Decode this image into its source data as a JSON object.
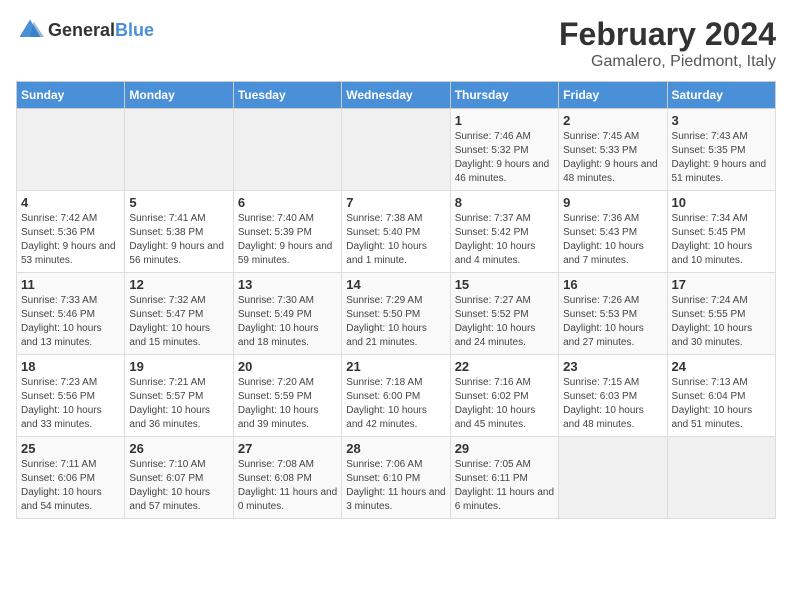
{
  "header": {
    "logo_general": "General",
    "logo_blue": "Blue",
    "title": "February 2024",
    "subtitle": "Gamalero, Piedmont, Italy"
  },
  "calendar": {
    "days_of_week": [
      "Sunday",
      "Monday",
      "Tuesday",
      "Wednesday",
      "Thursday",
      "Friday",
      "Saturday"
    ],
    "weeks": [
      [
        {
          "day": "",
          "info": ""
        },
        {
          "day": "",
          "info": ""
        },
        {
          "day": "",
          "info": ""
        },
        {
          "day": "",
          "info": ""
        },
        {
          "day": "1",
          "info": "Sunrise: 7:46 AM\nSunset: 5:32 PM\nDaylight: 9 hours\nand 46 minutes."
        },
        {
          "day": "2",
          "info": "Sunrise: 7:45 AM\nSunset: 5:33 PM\nDaylight: 9 hours\nand 48 minutes."
        },
        {
          "day": "3",
          "info": "Sunrise: 7:43 AM\nSunset: 5:35 PM\nDaylight: 9 hours\nand 51 minutes."
        }
      ],
      [
        {
          "day": "4",
          "info": "Sunrise: 7:42 AM\nSunset: 5:36 PM\nDaylight: 9 hours\nand 53 minutes."
        },
        {
          "day": "5",
          "info": "Sunrise: 7:41 AM\nSunset: 5:38 PM\nDaylight: 9 hours\nand 56 minutes."
        },
        {
          "day": "6",
          "info": "Sunrise: 7:40 AM\nSunset: 5:39 PM\nDaylight: 9 hours\nand 59 minutes."
        },
        {
          "day": "7",
          "info": "Sunrise: 7:38 AM\nSunset: 5:40 PM\nDaylight: 10 hours\nand 1 minute."
        },
        {
          "day": "8",
          "info": "Sunrise: 7:37 AM\nSunset: 5:42 PM\nDaylight: 10 hours\nand 4 minutes."
        },
        {
          "day": "9",
          "info": "Sunrise: 7:36 AM\nSunset: 5:43 PM\nDaylight: 10 hours\nand 7 minutes."
        },
        {
          "day": "10",
          "info": "Sunrise: 7:34 AM\nSunset: 5:45 PM\nDaylight: 10 hours\nand 10 minutes."
        }
      ],
      [
        {
          "day": "11",
          "info": "Sunrise: 7:33 AM\nSunset: 5:46 PM\nDaylight: 10 hours\nand 13 minutes."
        },
        {
          "day": "12",
          "info": "Sunrise: 7:32 AM\nSunset: 5:47 PM\nDaylight: 10 hours\nand 15 minutes."
        },
        {
          "day": "13",
          "info": "Sunrise: 7:30 AM\nSunset: 5:49 PM\nDaylight: 10 hours\nand 18 minutes."
        },
        {
          "day": "14",
          "info": "Sunrise: 7:29 AM\nSunset: 5:50 PM\nDaylight: 10 hours\nand 21 minutes."
        },
        {
          "day": "15",
          "info": "Sunrise: 7:27 AM\nSunset: 5:52 PM\nDaylight: 10 hours\nand 24 minutes."
        },
        {
          "day": "16",
          "info": "Sunrise: 7:26 AM\nSunset: 5:53 PM\nDaylight: 10 hours\nand 27 minutes."
        },
        {
          "day": "17",
          "info": "Sunrise: 7:24 AM\nSunset: 5:55 PM\nDaylight: 10 hours\nand 30 minutes."
        }
      ],
      [
        {
          "day": "18",
          "info": "Sunrise: 7:23 AM\nSunset: 5:56 PM\nDaylight: 10 hours\nand 33 minutes."
        },
        {
          "day": "19",
          "info": "Sunrise: 7:21 AM\nSunset: 5:57 PM\nDaylight: 10 hours\nand 36 minutes."
        },
        {
          "day": "20",
          "info": "Sunrise: 7:20 AM\nSunset: 5:59 PM\nDaylight: 10 hours\nand 39 minutes."
        },
        {
          "day": "21",
          "info": "Sunrise: 7:18 AM\nSunset: 6:00 PM\nDaylight: 10 hours\nand 42 minutes."
        },
        {
          "day": "22",
          "info": "Sunrise: 7:16 AM\nSunset: 6:02 PM\nDaylight: 10 hours\nand 45 minutes."
        },
        {
          "day": "23",
          "info": "Sunrise: 7:15 AM\nSunset: 6:03 PM\nDaylight: 10 hours\nand 48 minutes."
        },
        {
          "day": "24",
          "info": "Sunrise: 7:13 AM\nSunset: 6:04 PM\nDaylight: 10 hours\nand 51 minutes."
        }
      ],
      [
        {
          "day": "25",
          "info": "Sunrise: 7:11 AM\nSunset: 6:06 PM\nDaylight: 10 hours\nand 54 minutes."
        },
        {
          "day": "26",
          "info": "Sunrise: 7:10 AM\nSunset: 6:07 PM\nDaylight: 10 hours\nand 57 minutes."
        },
        {
          "day": "27",
          "info": "Sunrise: 7:08 AM\nSunset: 6:08 PM\nDaylight: 11 hours\nand 0 minutes."
        },
        {
          "day": "28",
          "info": "Sunrise: 7:06 AM\nSunset: 6:10 PM\nDaylight: 11 hours\nand 3 minutes."
        },
        {
          "day": "29",
          "info": "Sunrise: 7:05 AM\nSunset: 6:11 PM\nDaylight: 11 hours\nand 6 minutes."
        },
        {
          "day": "",
          "info": ""
        },
        {
          "day": "",
          "info": ""
        }
      ]
    ]
  }
}
